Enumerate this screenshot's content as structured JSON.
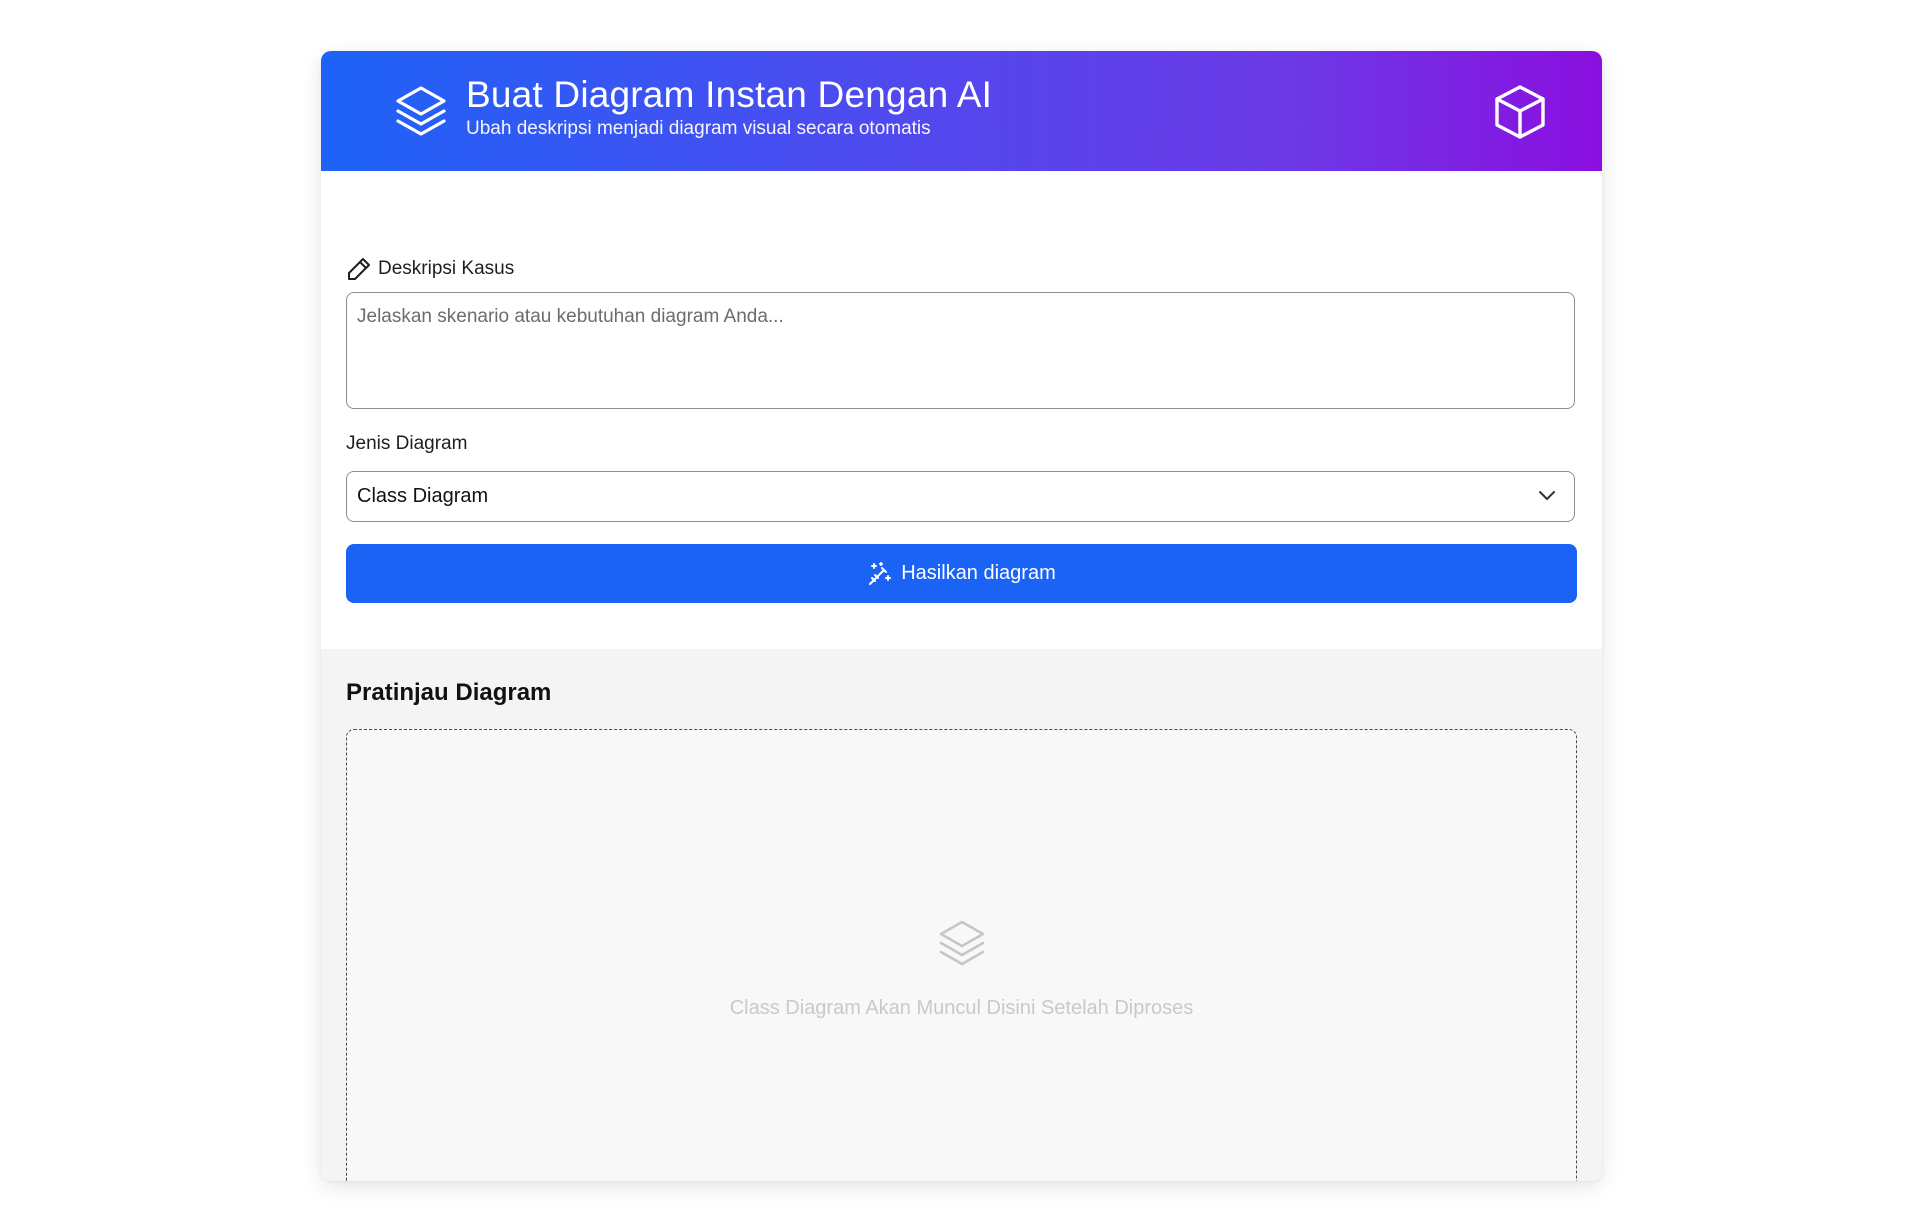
{
  "header": {
    "title": "Buat Diagram Instan Dengan AI",
    "subtitle": "Ubah deskripsi menjadi diagram visual secara otomatis",
    "logo_icon": "layers-icon",
    "right_icon": "cube-icon",
    "gradient": [
      "#1e63f7",
      "#8b0fe0"
    ]
  },
  "form": {
    "description_label": "Deskripsi Kasus",
    "description_icon": "pencil-icon",
    "description_placeholder": "Jelaskan skenario atau kebutuhan diagram Anda...",
    "description_value": "",
    "diagram_type_label": "Jenis Diagram",
    "diagram_type_selected": "Class Diagram",
    "generate_button_label": "Hasilkan diagram",
    "generate_button_icon": "magic-wand-icon",
    "accent_color": "#1a63f5"
  },
  "preview": {
    "title": "Pratinjau Diagram",
    "empty_icon": "layers-icon",
    "empty_message": "Class Diagram Akan Muncul Disini Setelah Diproses"
  }
}
